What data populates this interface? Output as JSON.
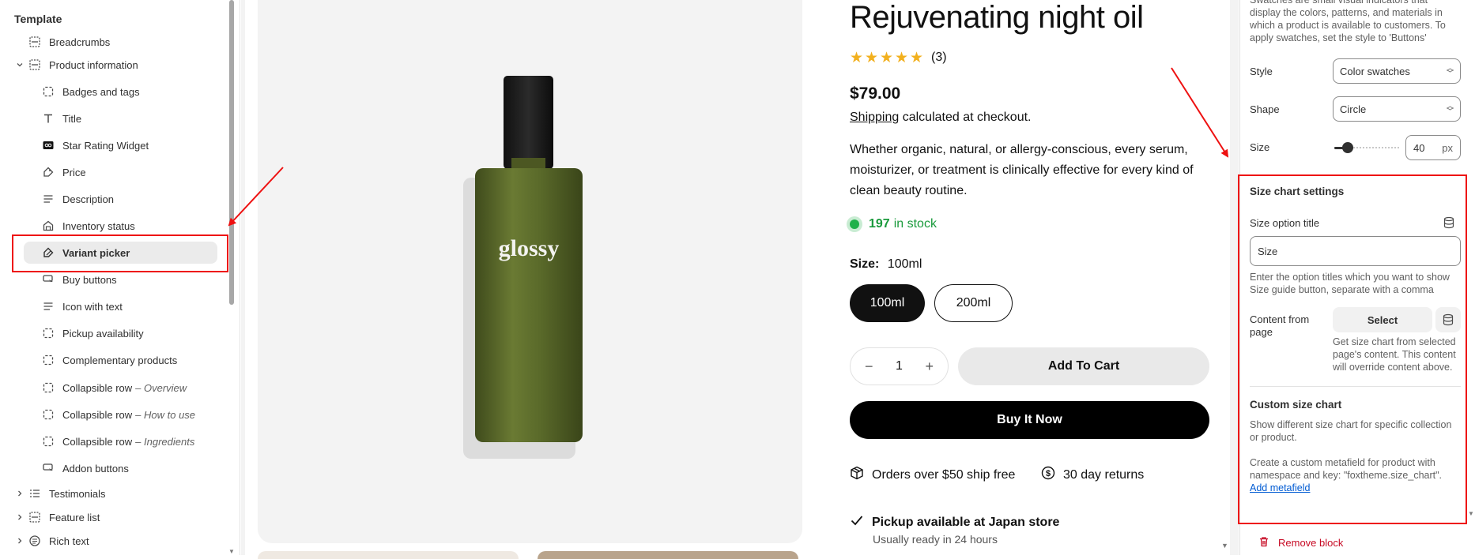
{
  "sidebar": {
    "section_title": "Template",
    "items": [
      {
        "label": "Breadcrumbs"
      },
      {
        "label": "Product information"
      },
      {
        "label": "Badges and tags"
      },
      {
        "label": "Title"
      },
      {
        "label": "Star Rating Widget"
      },
      {
        "label": "Price"
      },
      {
        "label": "Description"
      },
      {
        "label": "Inventory status"
      },
      {
        "label": "Variant picker"
      },
      {
        "label": "Buy buttons"
      },
      {
        "label": "Icon with text"
      },
      {
        "label": "Pickup availability"
      },
      {
        "label": "Complementary products"
      },
      {
        "label": "Collapsible row",
        "suffix": "– Overview"
      },
      {
        "label": "Collapsible row",
        "suffix": "– How to use"
      },
      {
        "label": "Collapsible row",
        "suffix": "– Ingredients"
      },
      {
        "label": "Addon buttons"
      },
      {
        "label": "Testimonials"
      },
      {
        "label": "Feature list"
      },
      {
        "label": "Rich text"
      }
    ]
  },
  "product": {
    "title": "Rejuvenating night oil",
    "rating_stars": 5,
    "review_count": "(3)",
    "price": "$79.00",
    "shipping_link": "Shipping",
    "shipping_rest": " calculated at checkout.",
    "description": "Whether organic, natural, or allergy-conscious, every serum, moisturizer, or treatment is clinically effective for every kind of clean beauty routine.",
    "stock_count": "197",
    "stock_text": "in stock",
    "size_label": "Size:",
    "size_value": "100ml",
    "options": [
      "100ml",
      "200ml"
    ],
    "quantity": "1",
    "add_to_cart": "Add To Cart",
    "buy_now": "Buy It Now",
    "feature_1": "Orders over $50 ship free",
    "feature_2": "30 day returns",
    "pickup_title": "Pickup available at Japan store",
    "pickup_sub": "Usually ready in 24 hours",
    "bottle_brand": "glossy",
    "bottle_color": "#5a6a2a"
  },
  "settings": {
    "swatch_help": "Swatches are small visual indicators that display the colors, patterns, and materials in which a product is available to customers. To apply swatches, set the style to 'Buttons'",
    "style_label": "Style",
    "style_value": "Color swatches",
    "shape_label": "Shape",
    "shape_value": "Circle",
    "size_label": "Size",
    "size_value": "40",
    "size_unit": "px",
    "size_slider_fraction": 0.2,
    "size_chart_heading": "Size chart settings",
    "size_option_title_label": "Size option title",
    "size_option_title_value": "Size",
    "size_option_help": "Enter the option titles which you want to show Size guide button, separate with a comma",
    "content_from_page_label": "Content from page",
    "select_label": "Select",
    "content_help": "Get size chart from selected page's content. This content will override content above.",
    "custom_heading": "Custom size chart",
    "custom_help_1": "Show different size chart for specific collection or product.",
    "custom_help_2": "Create a custom metafield for product with namespace and key: \"foxtheme.size_chart\".",
    "add_metafield": "Add metafield",
    "remove_block": "Remove block"
  },
  "colors": {
    "accent_red": "#e11111",
    "stock_green": "#1a9a3c",
    "link_blue": "#005bd3",
    "danger": "#c70a24"
  }
}
